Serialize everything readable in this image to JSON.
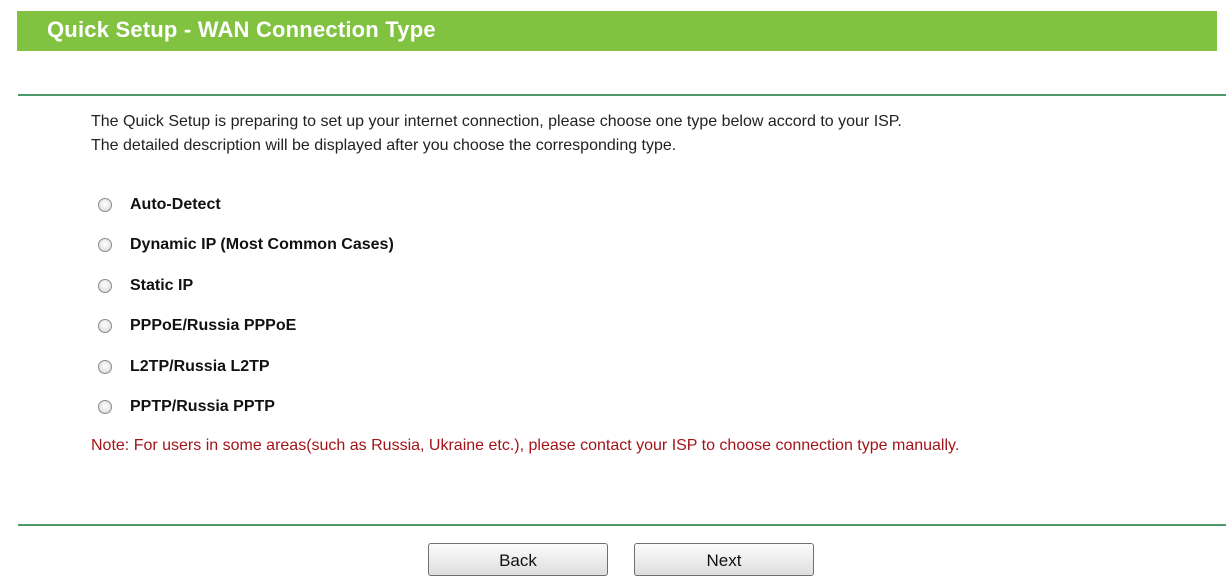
{
  "header": {
    "title": "Quick Setup - WAN Connection Type"
  },
  "intro": {
    "line1": "The Quick Setup is preparing to set up your internet connection, please choose one type below accord to your ISP.",
    "line2": "The detailed description will be displayed after you choose the corresponding type."
  },
  "connection_types": [
    {
      "label": "Auto-Detect",
      "selected": false
    },
    {
      "label": "Dynamic IP (Most Common Cases)",
      "selected": false
    },
    {
      "label": "Static IP",
      "selected": false
    },
    {
      "label": "PPPoE/Russia PPPoE",
      "selected": false
    },
    {
      "label": "L2TP/Russia L2TP",
      "selected": false
    },
    {
      "label": "PPTP/Russia PPTP",
      "selected": false
    }
  ],
  "note": "Note: For users in some areas(such as Russia, Ukraine etc.), please contact your ISP to choose connection type manually.",
  "buttons": {
    "back": "Back",
    "next": "Next"
  },
  "colors": {
    "title_bar": "#81c341",
    "divider": "#4c9a6b",
    "note_text": "#a3141a"
  }
}
